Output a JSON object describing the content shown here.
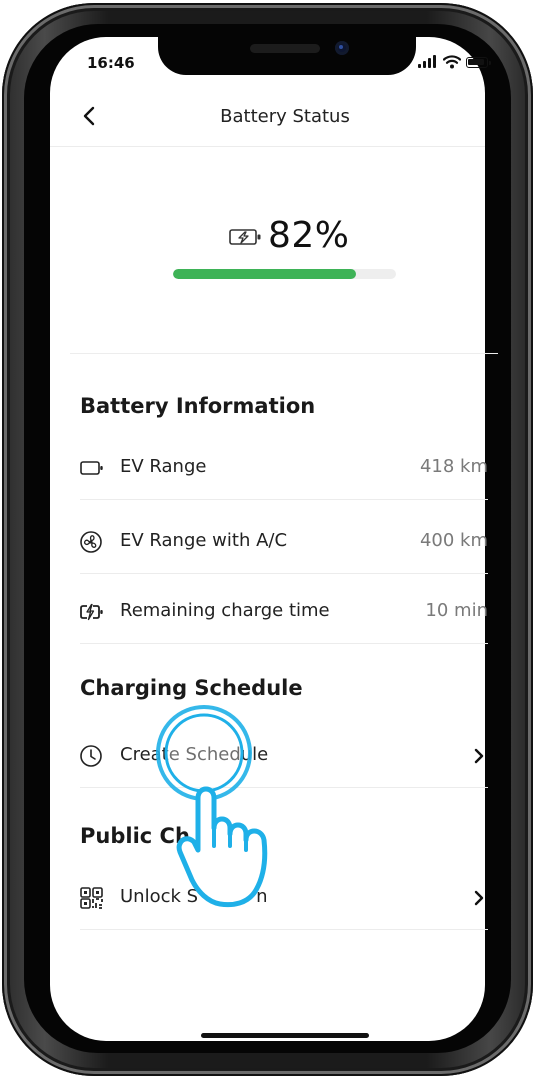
{
  "status_bar": {
    "time": "16:46"
  },
  "header": {
    "title": "Battery Status",
    "back_icon": "chevron-left-icon"
  },
  "battery": {
    "percent_label": "82%",
    "charge_fraction": 0.82,
    "icon": "charging-battery-icon"
  },
  "sections": {
    "battery_information": {
      "title": "Battery Information",
      "rows": [
        {
          "icon": "battery-icon",
          "label": "EV Range",
          "value": "418 km"
        },
        {
          "icon": "fan-icon",
          "label": "EV Range with A/C",
          "value": "400 km"
        },
        {
          "icon": "charging-battery-icon",
          "label": "Remaining charge time",
          "value": "10 min"
        }
      ]
    },
    "charging_schedule": {
      "title": "Charging Schedule",
      "rows": [
        {
          "icon": "clock-icon",
          "label": "Create Schedule",
          "chevron": "chevron-right-icon"
        }
      ]
    },
    "public_charging": {
      "title": "Public Ch",
      "rows": [
        {
          "icon": "qr-code-icon",
          "label": "Unlock S",
          "label_tail": "n",
          "chevron": "chevron-right-icon"
        }
      ]
    }
  },
  "colors": {
    "accent_green": "#3eb357",
    "tap_indicator": "#1fb0e8"
  }
}
